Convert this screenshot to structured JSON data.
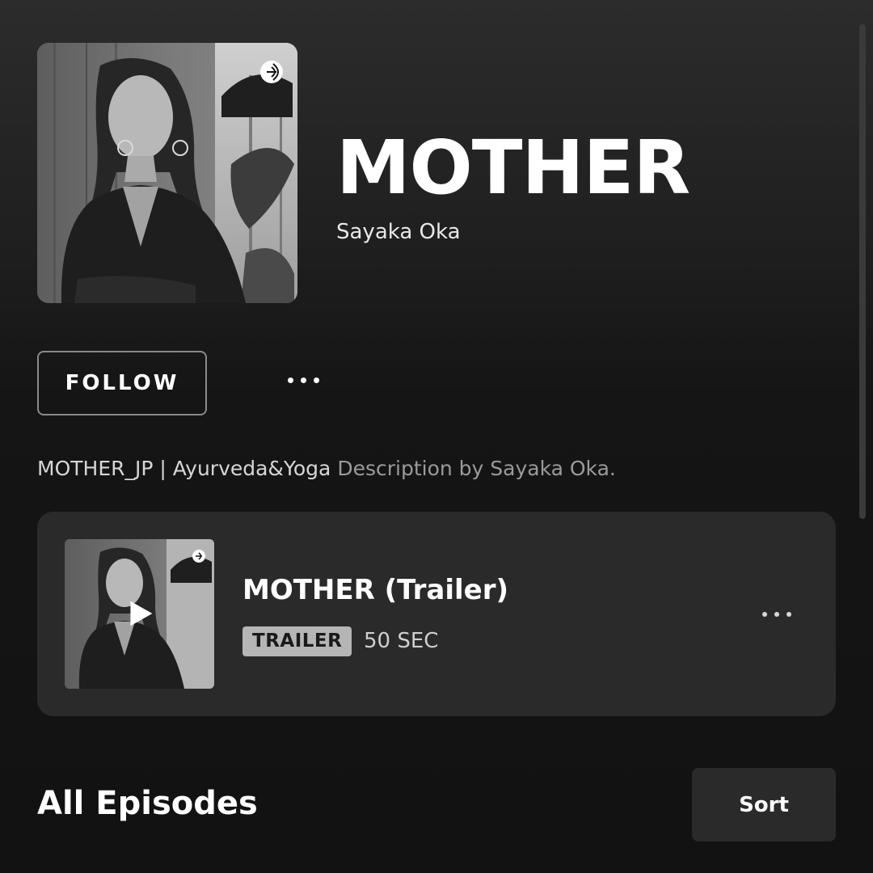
{
  "podcast": {
    "title": "MOTHER",
    "author": "Sayaka Oka",
    "cover_image": "podcast-cover-photo",
    "follow_label": "FOLLOW",
    "more_icon": "more-horizontal-icon",
    "description": "MOTHER_JP | Ayurveda&Yoga",
    "description_credit": "Description by Sayaka Oka."
  },
  "featured_episode": {
    "title": "MOTHER (Trailer)",
    "badge": "TRAILER",
    "duration": "50 SEC",
    "thumbnail_image": "episode-thumbnail-photo",
    "play_icon": "play-icon",
    "more_icon": "more-horizontal-icon"
  },
  "episodes_section": {
    "title": "All Episodes",
    "sort_label": "Sort"
  },
  "colors": {
    "background": "#121212",
    "card": "#2a2a2a",
    "badge": "#b5b5b5",
    "text_primary": "#ffffff",
    "text_secondary": "#9a9a9a"
  }
}
